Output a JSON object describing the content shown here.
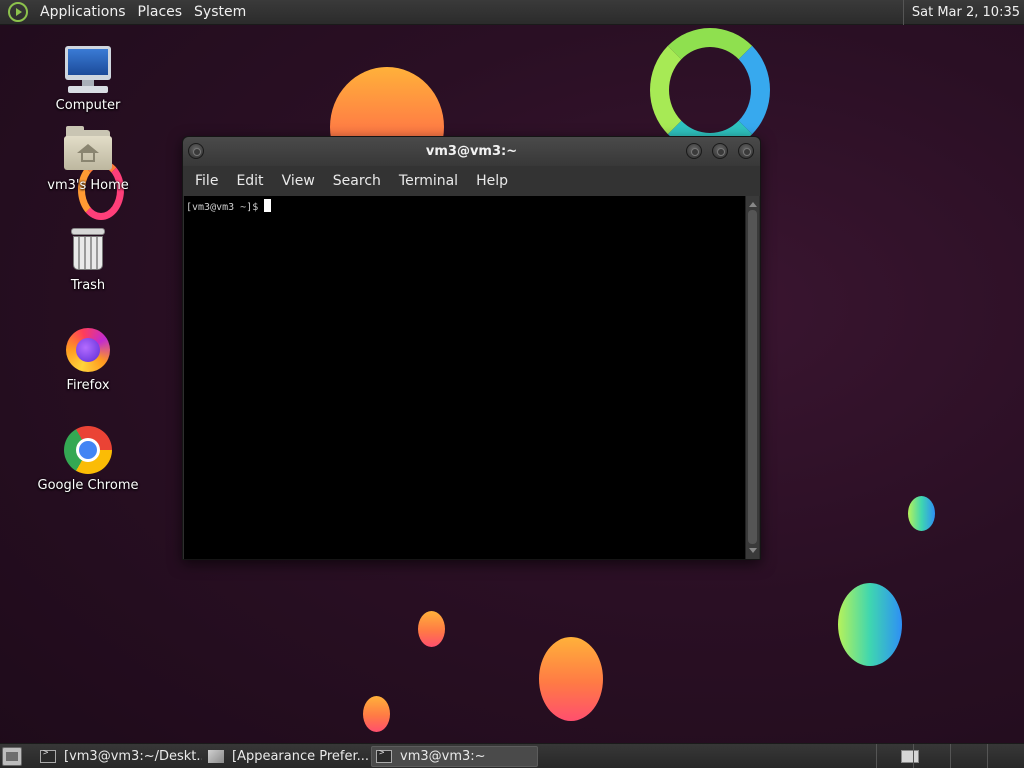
{
  "top_panel": {
    "menus": [
      "Applications",
      "Places",
      "System"
    ],
    "clock": "Sat Mar  2, 10:35"
  },
  "desktop": {
    "icons": [
      {
        "label": "Computer",
        "icon": "computer-icon"
      },
      {
        "label": "vm3's Home",
        "icon": "home-folder-icon"
      },
      {
        "label": "Trash",
        "icon": "trash-icon"
      },
      {
        "label": "Firefox",
        "icon": "firefox-icon"
      },
      {
        "label": "Google Chrome",
        "icon": "chrome-icon"
      }
    ]
  },
  "terminal_window": {
    "title": "vm3@vm3:~",
    "menu": [
      "File",
      "Edit",
      "View",
      "Search",
      "Terminal",
      "Help"
    ],
    "prompt": "[vm3@vm3 ~]$"
  },
  "taskbar": {
    "tasks": [
      {
        "label": "[vm3@vm3:~/Deskt...",
        "icon": "terminal-icon",
        "active": false
      },
      {
        "label": "[Appearance Prefer...",
        "icon": "appearance-icon",
        "active": false
      },
      {
        "label": "vm3@vm3:~",
        "icon": "terminal-icon",
        "active": true
      }
    ],
    "workspaces": 4,
    "active_workspace": 1
  },
  "colors": {
    "wallpaper": "#2a0f24",
    "panel": "#2f2f2f",
    "terminal_bg": "#000000",
    "accent_green": "#8cc24c"
  }
}
